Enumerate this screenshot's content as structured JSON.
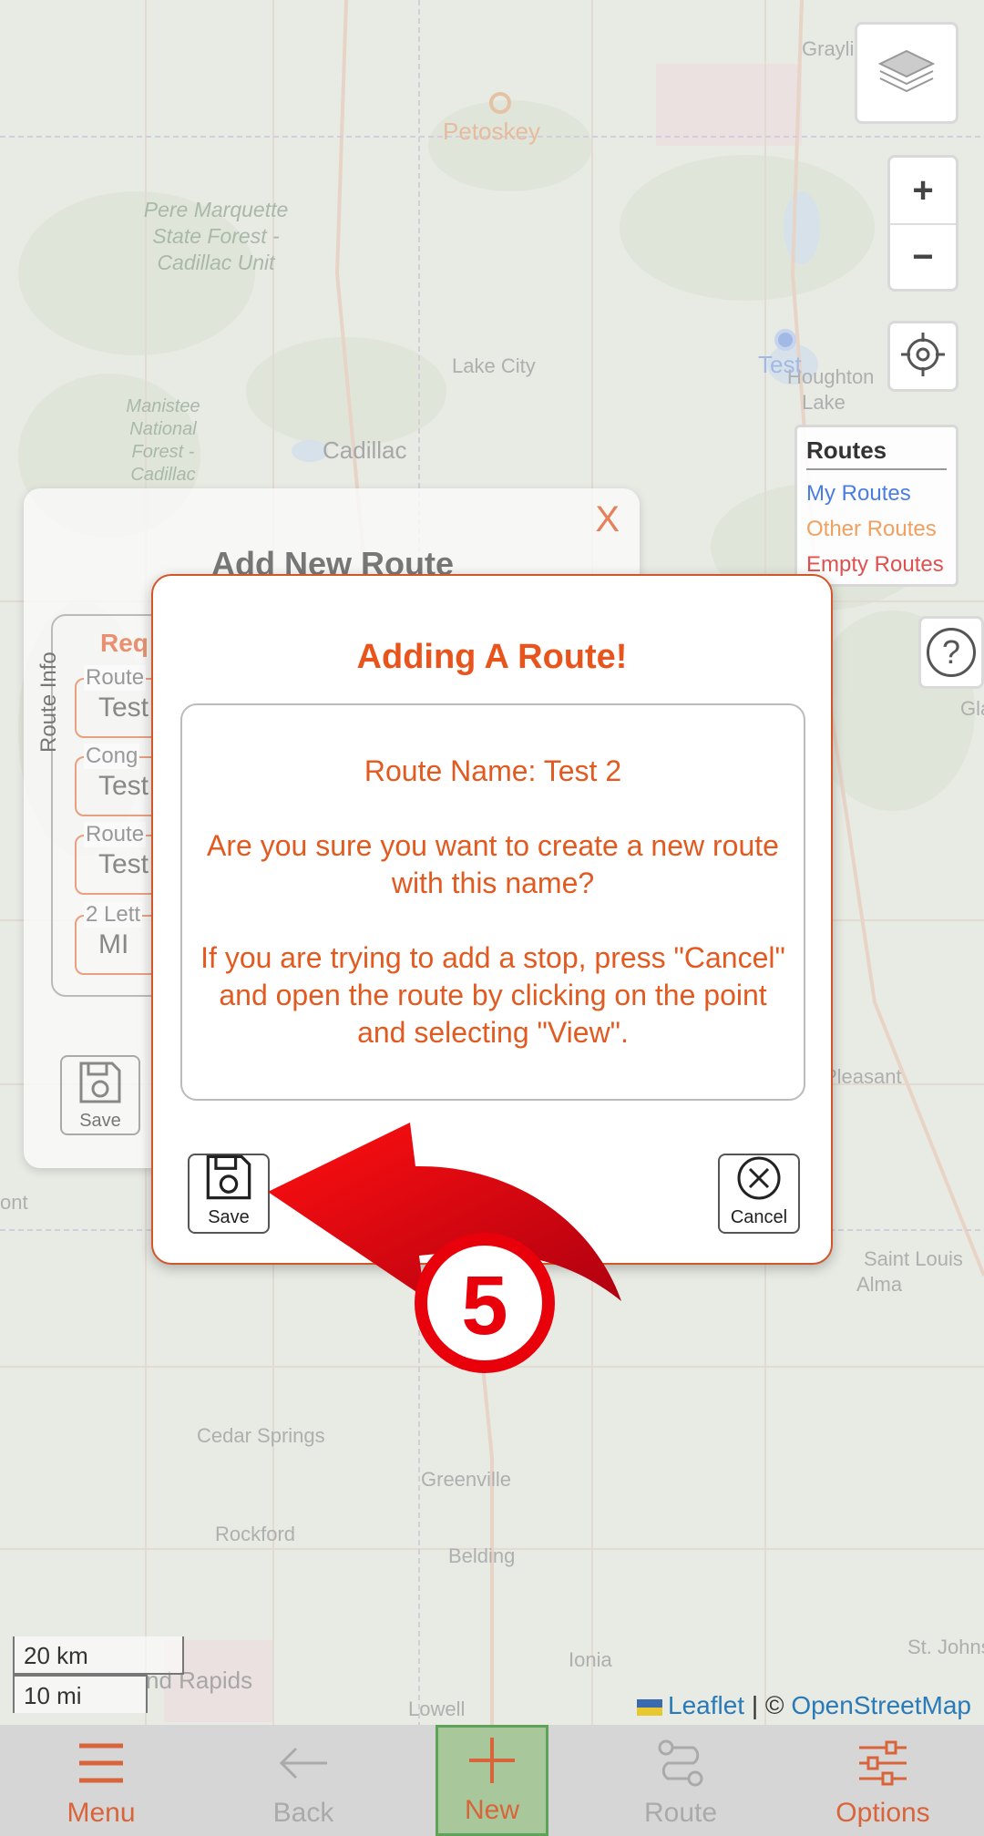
{
  "map": {
    "labels": [
      {
        "text": "Petoskey",
        "kind": "city-orange"
      },
      {
        "text": "Pere Marquette State Forest - Cadillac Unit",
        "kind": "forest"
      },
      {
        "text": "Lake City",
        "kind": "town"
      },
      {
        "text": "Cadillac",
        "kind": "city"
      },
      {
        "text": "Manistee National Forest - Cadillac",
        "kind": "forest"
      },
      {
        "text": "Houghton Lake",
        "kind": "town"
      },
      {
        "text": "Grayling",
        "kind": "town"
      },
      {
        "text": "Cedar Springs",
        "kind": "town"
      },
      {
        "text": "Greenville",
        "kind": "town"
      },
      {
        "text": "Rockford",
        "kind": "town"
      },
      {
        "text": "Belding",
        "kind": "town"
      },
      {
        "text": "Ionia",
        "kind": "town"
      },
      {
        "text": "Lowell",
        "kind": "town"
      },
      {
        "text": "Saint Louis",
        "kind": "town"
      },
      {
        "text": "Alma",
        "kind": "town"
      },
      {
        "text": "St. Johns",
        "kind": "town"
      },
      {
        "text": "Pleasant",
        "kind": "town"
      },
      {
        "text": "Gla",
        "kind": "town"
      },
      {
        "text": "ont",
        "kind": "town"
      },
      {
        "text": "nd Rapids",
        "kind": "city"
      }
    ],
    "point_label": "Test",
    "legend": {
      "title": "Routes",
      "items": [
        {
          "label": "My Routes",
          "color": "#4a7de0"
        },
        {
          "label": "Other Routes",
          "color": "#f0a060"
        },
        {
          "label": "Empty Routes",
          "color": "#e05050"
        }
      ]
    },
    "zoom_in": "+",
    "zoom_out": "−",
    "help": "?",
    "scale": {
      "km": "20 km",
      "mi": "10 mi"
    },
    "attribution": {
      "leaflet": "Leaflet",
      "sep": " | © ",
      "osm": "OpenStreetMap"
    }
  },
  "background_panel": {
    "close": "X",
    "title": "Add New Route",
    "section_label": "Route Info",
    "required_label": "Req",
    "fields": [
      {
        "label": "Route",
        "value": "Test"
      },
      {
        "label": "Cong",
        "value": "Test"
      },
      {
        "label": "Route",
        "value": "Test"
      },
      {
        "label": "2 Lett",
        "value": "MI"
      }
    ],
    "save_label": "Save"
  },
  "modal": {
    "title": "Adding A Route!",
    "route_name_line": "Route Name: Test 2",
    "confirm_text": "Are you sure you want to create a new route with this name?",
    "hint_text": "If you are trying to add a stop, press \"Cancel\" and open the route by clicking on the point and selecting \"View\".",
    "save_label": "Save",
    "cancel_label": "Cancel"
  },
  "annotation": {
    "step": "5",
    "color": "#e8000a"
  },
  "bottom_nav": [
    {
      "label": "Menu",
      "state": "enabled"
    },
    {
      "label": "Back",
      "state": "disabled"
    },
    {
      "label": "New",
      "state": "active"
    },
    {
      "label": "Route",
      "state": "disabled"
    },
    {
      "label": "Options",
      "state": "enabled"
    }
  ],
  "colors": {
    "accent": "#e8541c",
    "border": "#d2562a",
    "nav_bg": "#d6d6d6",
    "new_bg": "#a8c89c"
  }
}
